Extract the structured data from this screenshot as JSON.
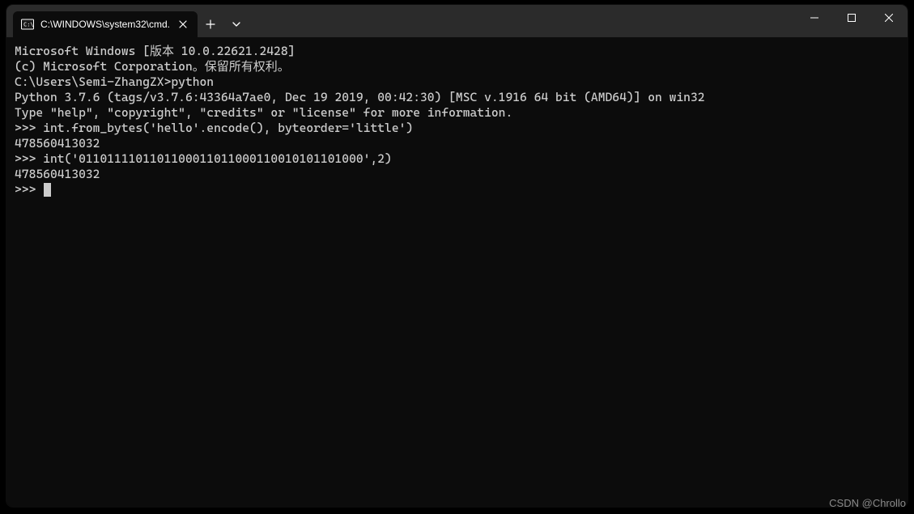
{
  "titlebar": {
    "tab_title": "C:\\WINDOWS\\system32\\cmd.",
    "new_tab_tooltip": "New Tab",
    "dropdown_tooltip": "Open profile dropdown"
  },
  "window_controls": {
    "minimize": "Minimize",
    "maximize": "Maximize",
    "close": "Close"
  },
  "terminal": {
    "lines": [
      "Microsoft Windows [版本 10.0.22621.2428]",
      "(c) Microsoft Corporation。保留所有权利。",
      "",
      "C:\\Users\\Semi-ZhangZX>python",
      "Python 3.7.6 (tags/v3.7.6:43364a7ae0, Dec 19 2019, 00:42:30) [MSC v.1916 64 bit (AMD64)] on win32",
      "Type \"help\", \"copyright\", \"credits\" or \"license\" for more information.",
      ">>> int.from_bytes('hello'.encode(), byteorder='little')",
      "478560413032",
      ">>> int('0110111101101100011011000110010101101000',2)",
      "478560413032",
      ">>> "
    ]
  },
  "watermark": "CSDN @Chrollo"
}
